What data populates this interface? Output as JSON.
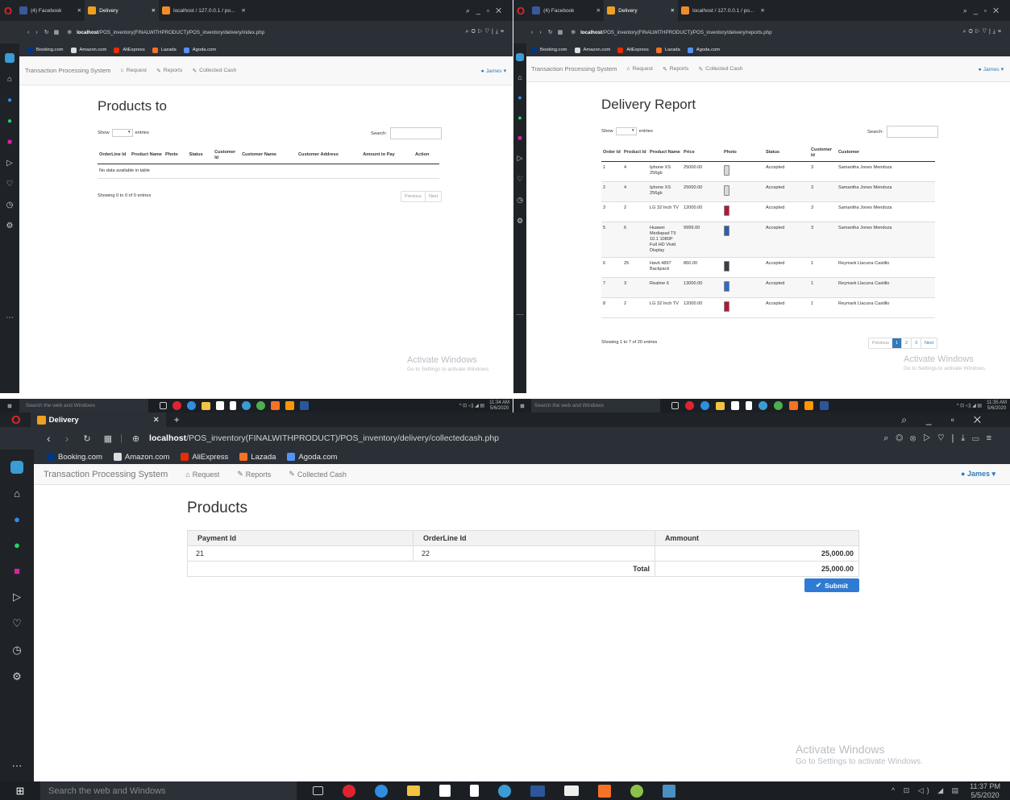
{
  "window1": {
    "tabs": [
      "(4) Facebook",
      "Delivery",
      "localhost / 127.0.0.1 / po..."
    ],
    "address_host": "localhost",
    "address_path": "/POS_inventory(FINALWITHPRODUCT)/POS_inventory/delivery/index.php",
    "bookmarks": [
      "Booking.com",
      "Amazon.com",
      "AliExpress",
      "Lazada",
      "Agoda.com"
    ],
    "nav": {
      "brand": "Transaction Processing System",
      "request": "Request",
      "reports": "Reports",
      "collected": "Collected Cash",
      "user": "James"
    },
    "heading": "Products to",
    "show_label": "Show",
    "entries_label": "entries",
    "search_label": "Search:",
    "columns": [
      "OrderLine Id",
      "Product Name",
      "Photo",
      "Status",
      "Customer Id",
      "Customer Name",
      "Customer Address",
      "Amount to Pay",
      "Action"
    ],
    "empty_text": "No data available in table",
    "info_text": "Showing 0 to 0 of 0 entries",
    "prev": "Previous",
    "next": "Next",
    "watermark_title": "Activate Windows",
    "watermark_sub": "Go to Settings to activate Windows.",
    "taskbar_search": "Search the web and Windows",
    "time": "11:34 AM",
    "date": "5/6/2020"
  },
  "window2": {
    "tabs": [
      "(4) Facebook",
      "Delivery",
      "localhost / 127.0.0.1 / po..."
    ],
    "address_host": "localhost",
    "address_path": "/POS_inventory(FINALWITHPRODUCT)/POS_inventory/delivery/reports.php",
    "bookmarks": [
      "Booking.com",
      "Amazon.com",
      "AliExpress",
      "Lazada",
      "Agoda.com"
    ],
    "nav": {
      "brand": "Transaction Processing System",
      "request": "Request",
      "reports": "Reports",
      "collected": "Collected Cash",
      "user": "James"
    },
    "heading": "Delivery Report",
    "show_label": "Show",
    "entries_label": "entries",
    "search_label": "Search:",
    "columns": [
      "Order Id",
      "Product Id",
      "Product Name",
      "Price",
      "Photo",
      "Status",
      "Customer Id",
      "Customer"
    ],
    "rows": [
      {
        "order": "1",
        "pid": "4",
        "name": "Iphone XS 256gb",
        "price": "25000.00",
        "color": "#d9d9d9",
        "status": "Accepted",
        "cid": "3",
        "customer": "Samantha Jones Mendoza"
      },
      {
        "order": "2",
        "pid": "4",
        "name": "Iphone XS 256gb",
        "price": "25000.00",
        "color": "#d9d9d9",
        "status": "Accepted",
        "cid": "3",
        "customer": "Samantha Jones Mendoza"
      },
      {
        "order": "3",
        "pid": "2",
        "name": "LG 32 Inch TV",
        "price": "12000.00",
        "color": "#b3163a",
        "status": "Accepted",
        "cid": "3",
        "customer": "Samantha Jones Mendoza"
      },
      {
        "order": "5",
        "pid": "6",
        "name": "Huawei Mediapad T5 10.1 1080P Full HD Vivid Display",
        "price": "9999.00",
        "color": "#2b5fae",
        "status": "Accepted",
        "cid": "3",
        "customer": "Samantha Jones Mendoza"
      },
      {
        "order": "6",
        "pid": "25",
        "name": "Havit 4897 Backpack",
        "price": "860.00",
        "color": "#3a3f45",
        "status": "Accepted",
        "cid": "1",
        "customer": "Reymark Llacuna Castillo"
      },
      {
        "order": "7",
        "pid": "3",
        "name": "Realme 6",
        "price": "13000.00",
        "color": "#2d6ad0",
        "status": "Accepted",
        "cid": "1",
        "customer": "Reymark Llacuna Castillo"
      },
      {
        "order": "8",
        "pid": "2",
        "name": "LG 32 Inch TV",
        "price": "12000.00",
        "color": "#b3163a",
        "status": "Accepted",
        "cid": "1",
        "customer": "Reymark Llacuna Castillo"
      }
    ],
    "info_text": "Showing 1 to 7 of 20 entries",
    "prev": "Previous",
    "pages": [
      "1",
      "2",
      "3"
    ],
    "next": "Next",
    "watermark_title": "Activate Windows",
    "watermark_sub": "Go to Settings to activate Windows.",
    "taskbar_search": "Search the web and Windows",
    "time": "11:35 AM",
    "date": "5/6/2020"
  },
  "window3": {
    "tab": "Delivery",
    "address_host": "localhost",
    "address_path": "/POS_inventory(FINALWITHPRODUCT)/POS_inventory/delivery/collectedcash.php",
    "bookmarks": [
      "Booking.com",
      "Amazon.com",
      "AliExpress",
      "Lazada",
      "Agoda.com"
    ],
    "nav": {
      "brand": "Transaction Processing System",
      "request": "Request",
      "reports": "Reports",
      "collected": "Collected Cash",
      "user": "James"
    },
    "heading": "Products",
    "columns": [
      "Payment Id",
      "OrderLine Id",
      "Ammount"
    ],
    "rows": [
      {
        "payment": "21",
        "orderline": "22",
        "amount": "25,000.00"
      }
    ],
    "total_label": "Total",
    "total_value": "25,000.00",
    "submit": "Submit",
    "watermark_title": "Activate Windows",
    "watermark_sub": "Go to Settings to activate Windows.",
    "taskbar_search": "Search the web and Windows",
    "time": "11:37 PM",
    "date": "5/5/2020"
  },
  "colors": {
    "accent": "#337ab7",
    "submit": "#2f7bd3",
    "opera_red": "#e0242f",
    "chrome": "#1f2327"
  }
}
